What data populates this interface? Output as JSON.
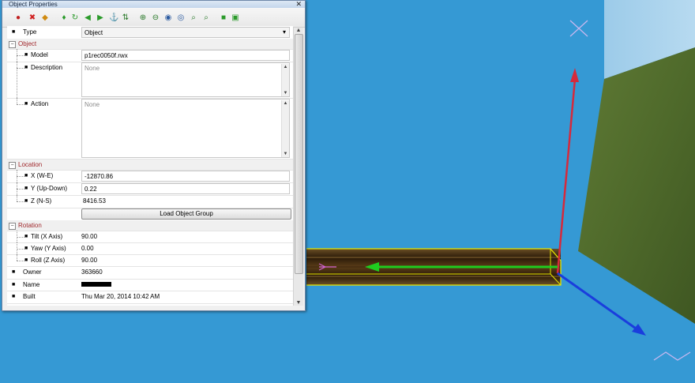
{
  "window": {
    "title": "Object Properties",
    "close_glyph": "✕"
  },
  "toolbar": {
    "icons": [
      "red-tool-icon",
      "delete-x-icon",
      "warning-icon",
      "pin-green-icon",
      "rotate-icon",
      "arrow-left-icon",
      "arrow-right-icon",
      "anchor-icon",
      "flip-icon",
      "zoom-in-icon",
      "zoom-out-icon",
      "camera-icon",
      "camera-move-icon",
      "zoom-search-icon",
      "zoom-search-alt-icon",
      "lock-icon",
      "group-icon"
    ]
  },
  "grid": {
    "type": {
      "label": "Type",
      "value": "Object"
    },
    "object_section": "Object",
    "model": {
      "label": "Model",
      "value": "p1rec0050f.rwx"
    },
    "description": {
      "label": "Description",
      "placeholder": "None"
    },
    "action": {
      "label": "Action",
      "placeholder": "None"
    },
    "location_section": "Location",
    "x": {
      "label": "X (W-E)",
      "value": "-12870.86"
    },
    "y": {
      "label": "Y (Up-Down)",
      "value": "0.22"
    },
    "z": {
      "label": "Z (N-S)",
      "value": "8416.53"
    },
    "load_button": "Load Object Group",
    "rotation_section": "Rotation",
    "tilt": {
      "label": "Tilt (X Axis)",
      "value": "90.00"
    },
    "yaw": {
      "label": "Yaw (Y Axis)",
      "value": "0.00"
    },
    "roll": {
      "label": "Roll (Z Axis)",
      "value": "90.00"
    },
    "owner": {
      "label": "Owner",
      "value": "363660"
    },
    "name": {
      "label": "Name"
    },
    "built": {
      "label": "Built",
      "value": "Thu Mar 20, 2014 10:42 AM"
    }
  },
  "colors": {
    "sky": "#3599d4",
    "grass": "#556b2e",
    "wall": "#a9d2ec",
    "axis_x": "#d52a3c",
    "axis_y": "#1fcc1f",
    "axis_z": "#1a3ddd",
    "section_text": "#a0282c"
  }
}
